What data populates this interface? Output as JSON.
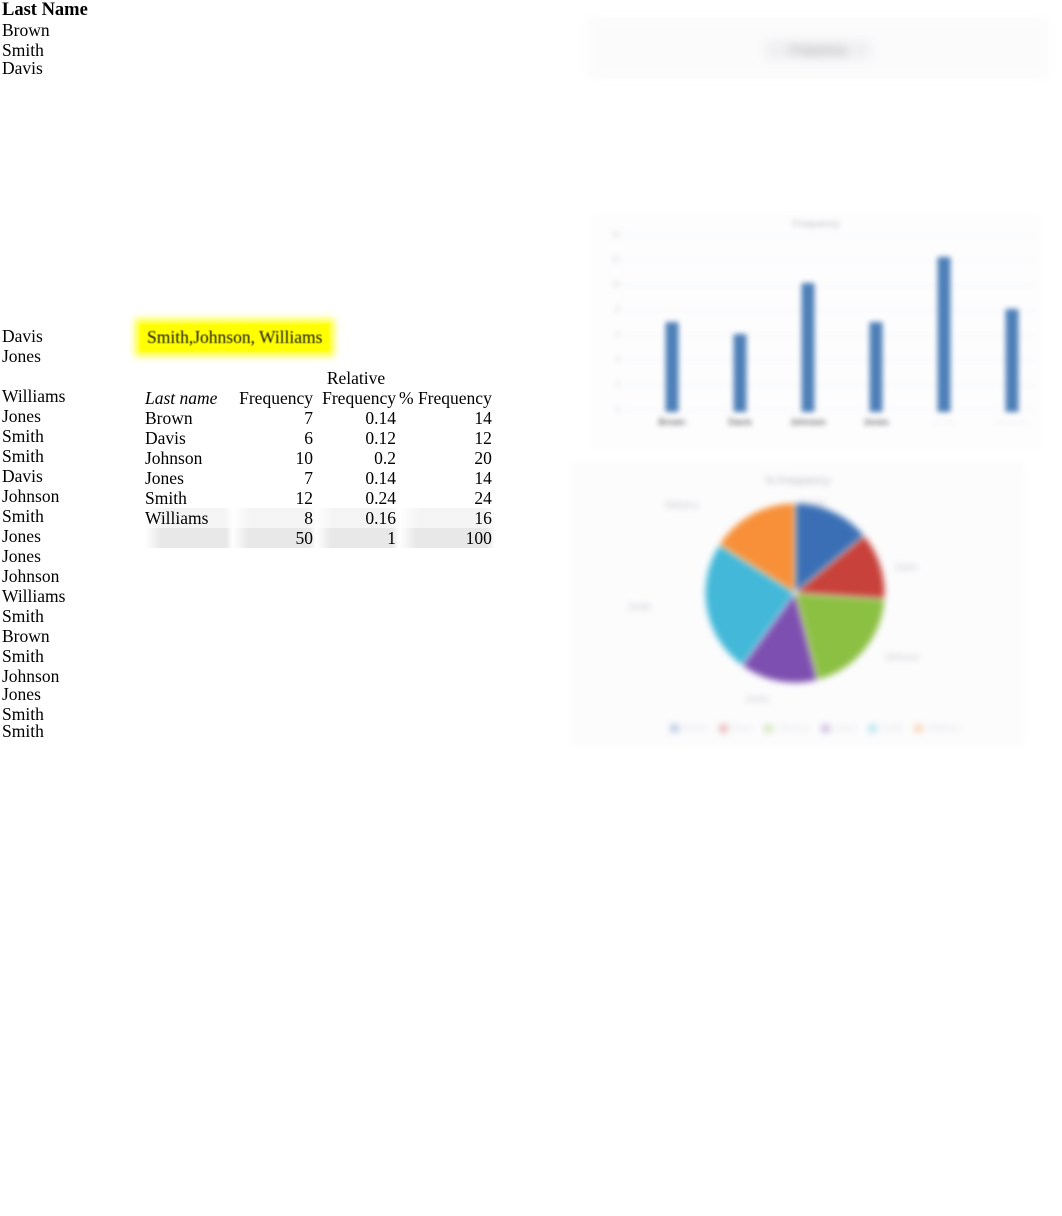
{
  "raw_data": {
    "header": "Last Name",
    "top_items": [
      "Brown",
      "Smith"
    ],
    "clipped_top_item": "Davis",
    "items": [
      "Davis",
      "Jones",
      "Williams",
      "Jones",
      "Smith",
      "Smith",
      "Davis",
      "Johnson",
      "Smith",
      "Jones",
      "Jones",
      "Johnson",
      "Williams",
      "Smith",
      "Brown",
      "Smith",
      "Johnson",
      "Jones",
      "Smith"
    ],
    "clipped_bottom_item": "Smith"
  },
  "note": {
    "text": "Smith,Johnson, Williams",
    "highlight_color": "#ffff00"
  },
  "table": {
    "headers": {
      "name": "Last name",
      "frequency": "Frequency",
      "relative_top": "Relative",
      "relative": "Frequency",
      "percent": "% Frequency"
    },
    "rows": [
      {
        "name": "Brown",
        "frequency": "7",
        "relative": "0.14",
        "percent": "14"
      },
      {
        "name": "Davis",
        "frequency": "6",
        "relative": "0.12",
        "percent": "12"
      },
      {
        "name": "Johnson",
        "frequency": "10",
        "relative": "0.2",
        "percent": "20"
      },
      {
        "name": "Jones",
        "frequency": "7",
        "relative": "0.14",
        "percent": "14"
      },
      {
        "name": "Smith",
        "frequency": "12",
        "relative": "0.24",
        "percent": "24"
      },
      {
        "name": "Williams",
        "frequency": "8",
        "relative": "0.16",
        "percent": "16"
      }
    ],
    "totals": {
      "name": "",
      "frequency": "50",
      "relative": "1",
      "percent": "100"
    }
  },
  "top_panel": {
    "title": "Frequency"
  },
  "chart_data": [
    {
      "type": "bar",
      "title": "Frequency",
      "categories": [
        "Brown",
        "Davis",
        "Johnson",
        "Jones",
        "Smith",
        "Williams"
      ],
      "values": [
        7,
        6,
        10,
        7,
        12,
        8
      ],
      "visible_tick_labels": [
        "Brown",
        "Davis",
        "Johnson",
        "Jones"
      ],
      "xlabel": "",
      "ylabel": "",
      "ylim": [
        0,
        14
      ],
      "yticks": [
        "14",
        "12",
        "10",
        "8",
        "6",
        "4",
        "2",
        "0"
      ],
      "grid": true,
      "legend": "none",
      "bar_color": "#4e7fb8"
    },
    {
      "type": "pie",
      "title": "% Frequency",
      "categories": [
        "Brown",
        "Davis",
        "Johnson",
        "Jones",
        "Smith",
        "Williams"
      ],
      "values": [
        14,
        12,
        20,
        14,
        24,
        16
      ],
      "colors": [
        "#3b6fb5",
        "#c8413a",
        "#8cc043",
        "#7d4fb0",
        "#43b8d8",
        "#f79039"
      ],
      "legend": "bottom",
      "slice_labels": [
        "Brown",
        "Davis",
        "Johnson",
        "Jones",
        "Smith",
        "Williams"
      ]
    }
  ]
}
